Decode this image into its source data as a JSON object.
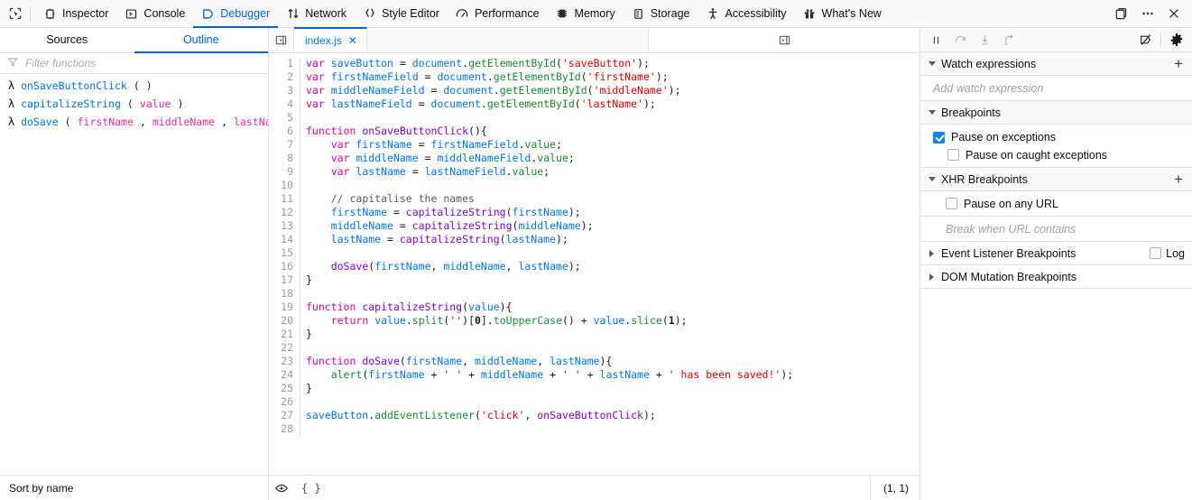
{
  "toolbar": {
    "picker_icon": "element-picker-icon",
    "tools": [
      {
        "label": "Inspector",
        "icon": "inspector-icon",
        "active": false
      },
      {
        "label": "Console",
        "icon": "console-icon",
        "active": false
      },
      {
        "label": "Debugger",
        "icon": "debugger-icon",
        "active": true
      },
      {
        "label": "Network",
        "icon": "network-icon",
        "active": false
      },
      {
        "label": "Style Editor",
        "icon": "style-editor-icon",
        "active": false
      },
      {
        "label": "Performance",
        "icon": "performance-icon",
        "active": false
      },
      {
        "label": "Memory",
        "icon": "memory-icon",
        "active": false
      },
      {
        "label": "Storage",
        "icon": "storage-icon",
        "active": false
      },
      {
        "label": "Accessibility",
        "icon": "accessibility-icon",
        "active": false
      },
      {
        "label": "What's New",
        "icon": "whats-new-icon",
        "active": false
      }
    ],
    "right_buttons": [
      {
        "name": "dock-layout-icon",
        "glyph": "dock"
      },
      {
        "name": "meatball-menu-icon",
        "glyph": "dots"
      },
      {
        "name": "close-devtools-icon",
        "glyph": "close"
      }
    ]
  },
  "left_panel": {
    "tabs": [
      {
        "label": "Sources",
        "active": false
      },
      {
        "label": "Outline",
        "active": true
      }
    ],
    "filter": {
      "value": "",
      "placeholder": "Filter functions",
      "icon": "filter-icon"
    },
    "outline": [
      {
        "symbol": "λ",
        "name": "onSaveButtonClick",
        "open": "(",
        "params": [],
        "close": ")"
      },
      {
        "symbol": "λ",
        "name": "capitalizeString",
        "open": "(",
        "params": [
          "value"
        ],
        "close": ")"
      },
      {
        "symbol": "λ",
        "name": "doSave",
        "open": "(",
        "params": [
          "firstName",
          "middleName",
          "lastName"
        ],
        "close": ")"
      }
    ],
    "footer_label": "Sort by name"
  },
  "editor": {
    "scroll_left_icon": "scroll-tabs-left-icon",
    "scroll_right_icon": "scroll-tabs-right-icon",
    "tab": {
      "label": "index.js",
      "close_glyph": "✕",
      "active": true
    },
    "footer": {
      "eye_icon": "toggle-preview-icon",
      "prettyprint_label": "{ }",
      "cursor_position": "(1, 1)"
    },
    "line_count": 28,
    "lines": [
      {
        "n": 1,
        "tokens": [
          {
            "t": "var",
            "c": "kw"
          },
          {
            "t": " ",
            "c": "pn"
          },
          {
            "t": "saveButton",
            "c": "var"
          },
          {
            "t": " = ",
            "c": "pn"
          },
          {
            "t": "document",
            "c": "var"
          },
          {
            "t": ".",
            "c": "pn"
          },
          {
            "t": "getElementById",
            "c": "meth"
          },
          {
            "t": "(",
            "c": "pn"
          },
          {
            "t": "'saveButton'",
            "c": "str"
          },
          {
            "t": ");",
            "c": "pn"
          }
        ]
      },
      {
        "n": 2,
        "tokens": [
          {
            "t": "var",
            "c": "kw"
          },
          {
            "t": " ",
            "c": "pn"
          },
          {
            "t": "firstNameField",
            "c": "var"
          },
          {
            "t": " = ",
            "c": "pn"
          },
          {
            "t": "document",
            "c": "var"
          },
          {
            "t": ".",
            "c": "pn"
          },
          {
            "t": "getElementById",
            "c": "meth"
          },
          {
            "t": "(",
            "c": "pn"
          },
          {
            "t": "'firstName'",
            "c": "str"
          },
          {
            "t": ");",
            "c": "pn"
          }
        ]
      },
      {
        "n": 3,
        "tokens": [
          {
            "t": "var",
            "c": "kw"
          },
          {
            "t": " ",
            "c": "pn"
          },
          {
            "t": "middleNameField",
            "c": "var"
          },
          {
            "t": " = ",
            "c": "pn"
          },
          {
            "t": "document",
            "c": "var"
          },
          {
            "t": ".",
            "c": "pn"
          },
          {
            "t": "getElementById",
            "c": "meth"
          },
          {
            "t": "(",
            "c": "pn"
          },
          {
            "t": "'middleName'",
            "c": "str"
          },
          {
            "t": ");",
            "c": "pn"
          }
        ]
      },
      {
        "n": 4,
        "tokens": [
          {
            "t": "var",
            "c": "kw"
          },
          {
            "t": " ",
            "c": "pn"
          },
          {
            "t": "lastNameField",
            "c": "var"
          },
          {
            "t": " = ",
            "c": "pn"
          },
          {
            "t": "document",
            "c": "var"
          },
          {
            "t": ".",
            "c": "pn"
          },
          {
            "t": "getElementById",
            "c": "meth"
          },
          {
            "t": "(",
            "c": "pn"
          },
          {
            "t": "'lastName'",
            "c": "str"
          },
          {
            "t": ");",
            "c": "pn"
          }
        ]
      },
      {
        "n": 5,
        "tokens": []
      },
      {
        "n": 6,
        "tokens": [
          {
            "t": "function",
            "c": "kw"
          },
          {
            "t": " ",
            "c": "pn"
          },
          {
            "t": "onSaveButtonClick",
            "c": "fn"
          },
          {
            "t": "(){",
            "c": "pn"
          }
        ]
      },
      {
        "n": 7,
        "tokens": [
          {
            "t": "    ",
            "c": "pn"
          },
          {
            "t": "var",
            "c": "kw"
          },
          {
            "t": " ",
            "c": "pn"
          },
          {
            "t": "firstName",
            "c": "var"
          },
          {
            "t": " = ",
            "c": "pn"
          },
          {
            "t": "firstNameField",
            "c": "var"
          },
          {
            "t": ".",
            "c": "pn"
          },
          {
            "t": "value",
            "c": "meth"
          },
          {
            "t": ";",
            "c": "pn"
          }
        ]
      },
      {
        "n": 8,
        "tokens": [
          {
            "t": "    ",
            "c": "pn"
          },
          {
            "t": "var",
            "c": "kw"
          },
          {
            "t": " ",
            "c": "pn"
          },
          {
            "t": "middleName",
            "c": "var"
          },
          {
            "t": " = ",
            "c": "pn"
          },
          {
            "t": "middleNameField",
            "c": "var"
          },
          {
            "t": ".",
            "c": "pn"
          },
          {
            "t": "value",
            "c": "meth"
          },
          {
            "t": ";",
            "c": "pn"
          }
        ]
      },
      {
        "n": 9,
        "tokens": [
          {
            "t": "    ",
            "c": "pn"
          },
          {
            "t": "var",
            "c": "kw"
          },
          {
            "t": " ",
            "c": "pn"
          },
          {
            "t": "lastName",
            "c": "var"
          },
          {
            "t": " = ",
            "c": "pn"
          },
          {
            "t": "lastNameField",
            "c": "var"
          },
          {
            "t": ".",
            "c": "pn"
          },
          {
            "t": "value",
            "c": "meth"
          },
          {
            "t": ";",
            "c": "pn"
          }
        ]
      },
      {
        "n": 10,
        "tokens": []
      },
      {
        "n": 11,
        "tokens": [
          {
            "t": "    ",
            "c": "pn"
          },
          {
            "t": "// capitalise the names",
            "c": "cmt"
          }
        ]
      },
      {
        "n": 12,
        "tokens": [
          {
            "t": "    ",
            "c": "pn"
          },
          {
            "t": "firstName",
            "c": "var"
          },
          {
            "t": " = ",
            "c": "pn"
          },
          {
            "t": "capitalizeString",
            "c": "fn"
          },
          {
            "t": "(",
            "c": "pn"
          },
          {
            "t": "firstName",
            "c": "var"
          },
          {
            "t": ");",
            "c": "pn"
          }
        ]
      },
      {
        "n": 13,
        "tokens": [
          {
            "t": "    ",
            "c": "pn"
          },
          {
            "t": "middleName",
            "c": "var"
          },
          {
            "t": " = ",
            "c": "pn"
          },
          {
            "t": "capitalizeString",
            "c": "fn"
          },
          {
            "t": "(",
            "c": "pn"
          },
          {
            "t": "middleName",
            "c": "var"
          },
          {
            "t": ");",
            "c": "pn"
          }
        ]
      },
      {
        "n": 14,
        "tokens": [
          {
            "t": "    ",
            "c": "pn"
          },
          {
            "t": "lastName",
            "c": "var"
          },
          {
            "t": " = ",
            "c": "pn"
          },
          {
            "t": "capitalizeString",
            "c": "fn"
          },
          {
            "t": "(",
            "c": "pn"
          },
          {
            "t": "lastName",
            "c": "var"
          },
          {
            "t": ");",
            "c": "pn"
          }
        ]
      },
      {
        "n": 15,
        "tokens": []
      },
      {
        "n": 16,
        "tokens": [
          {
            "t": "    ",
            "c": "pn"
          },
          {
            "t": "doSave",
            "c": "fn"
          },
          {
            "t": "(",
            "c": "pn"
          },
          {
            "t": "firstName",
            "c": "var"
          },
          {
            "t": ", ",
            "c": "pn"
          },
          {
            "t": "middleName",
            "c": "var"
          },
          {
            "t": ", ",
            "c": "pn"
          },
          {
            "t": "lastName",
            "c": "var"
          },
          {
            "t": ");",
            "c": "pn"
          }
        ]
      },
      {
        "n": 17,
        "tokens": [
          {
            "t": "}",
            "c": "pn"
          }
        ]
      },
      {
        "n": 18,
        "tokens": []
      },
      {
        "n": 19,
        "tokens": [
          {
            "t": "function",
            "c": "kw"
          },
          {
            "t": " ",
            "c": "pn"
          },
          {
            "t": "capitalizeString",
            "c": "fn"
          },
          {
            "t": "(",
            "c": "pn"
          },
          {
            "t": "value",
            "c": "var"
          },
          {
            "t": "){",
            "c": "pn"
          }
        ]
      },
      {
        "n": 20,
        "tokens": [
          {
            "t": "    ",
            "c": "pn"
          },
          {
            "t": "return",
            "c": "kw"
          },
          {
            "t": " ",
            "c": "pn"
          },
          {
            "t": "value",
            "c": "var"
          },
          {
            "t": ".",
            "c": "pn"
          },
          {
            "t": "split",
            "c": "meth"
          },
          {
            "t": "(",
            "c": "pn"
          },
          {
            "t": "''",
            "c": "str"
          },
          {
            "t": ")[",
            "c": "pn"
          },
          {
            "t": "0",
            "c": "num"
          },
          {
            "t": "].",
            "c": "pn"
          },
          {
            "t": "toUpperCase",
            "c": "meth"
          },
          {
            "t": "() + ",
            "c": "pn"
          },
          {
            "t": "value",
            "c": "var"
          },
          {
            "t": ".",
            "c": "pn"
          },
          {
            "t": "slice",
            "c": "meth"
          },
          {
            "t": "(",
            "c": "pn"
          },
          {
            "t": "1",
            "c": "num"
          },
          {
            "t": ");",
            "c": "pn"
          }
        ]
      },
      {
        "n": 21,
        "tokens": [
          {
            "t": "}",
            "c": "pn"
          }
        ]
      },
      {
        "n": 22,
        "tokens": []
      },
      {
        "n": 23,
        "tokens": [
          {
            "t": "function",
            "c": "kw"
          },
          {
            "t": " ",
            "c": "pn"
          },
          {
            "t": "doSave",
            "c": "fn"
          },
          {
            "t": "(",
            "c": "pn"
          },
          {
            "t": "firstName",
            "c": "var"
          },
          {
            "t": ", ",
            "c": "pn"
          },
          {
            "t": "middleName",
            "c": "var"
          },
          {
            "t": ", ",
            "c": "pn"
          },
          {
            "t": "lastName",
            "c": "var"
          },
          {
            "t": "){",
            "c": "pn"
          }
        ]
      },
      {
        "n": 24,
        "tokens": [
          {
            "t": "    ",
            "c": "pn"
          },
          {
            "t": "alert",
            "c": "meth"
          },
          {
            "t": "(",
            "c": "pn"
          },
          {
            "t": "firstName",
            "c": "var"
          },
          {
            "t": " + ",
            "c": "pn"
          },
          {
            "t": "' '",
            "c": "str"
          },
          {
            "t": " + ",
            "c": "pn"
          },
          {
            "t": "middleName",
            "c": "var"
          },
          {
            "t": " + ",
            "c": "pn"
          },
          {
            "t": "' '",
            "c": "str"
          },
          {
            "t": " + ",
            "c": "pn"
          },
          {
            "t": "lastName",
            "c": "var"
          },
          {
            "t": " + ",
            "c": "pn"
          },
          {
            "t": "' has been saved!'",
            "c": "str"
          },
          {
            "t": ");",
            "c": "pn"
          }
        ]
      },
      {
        "n": 25,
        "tokens": [
          {
            "t": "}",
            "c": "pn"
          }
        ]
      },
      {
        "n": 26,
        "tokens": []
      },
      {
        "n": 27,
        "tokens": [
          {
            "t": "saveButton",
            "c": "var"
          },
          {
            "t": ".",
            "c": "pn"
          },
          {
            "t": "addEventListener",
            "c": "meth"
          },
          {
            "t": "(",
            "c": "pn"
          },
          {
            "t": "'click'",
            "c": "str"
          },
          {
            "t": ", ",
            "c": "pn"
          },
          {
            "t": "onSaveButtonClick",
            "c": "fn"
          },
          {
            "t": ");",
            "c": "pn"
          }
        ]
      },
      {
        "n": 28,
        "tokens": []
      }
    ]
  },
  "right_panel": {
    "controls": [
      {
        "name": "resume-pause-button",
        "icon": "pause-icon",
        "enabled": true
      },
      {
        "name": "step-over-button",
        "icon": "step-over-icon",
        "enabled": false
      },
      {
        "name": "step-in-button",
        "icon": "step-in-icon",
        "enabled": false
      },
      {
        "name": "step-out-button",
        "icon": "step-out-icon",
        "enabled": false
      },
      {
        "name": "deactivate-breakpoints-button",
        "icon": "breakpoints-disabled-icon",
        "enabled": true
      },
      {
        "name": "debugger-settings-button",
        "icon": "gear-icon",
        "enabled": true
      }
    ],
    "watch": {
      "title": "Watch expressions",
      "add_glyph": "+",
      "placeholder": "Add watch expression",
      "expanded": true
    },
    "breakpoints": {
      "title": "Breakpoints",
      "expanded": true,
      "pause_on_exceptions": {
        "label": "Pause on exceptions",
        "checked": true
      },
      "pause_on_caught": {
        "label": "Pause on caught exceptions",
        "checked": false
      }
    },
    "xhr": {
      "title": "XHR Breakpoints",
      "add_glyph": "+",
      "expanded": true,
      "pause_any_url": {
        "label": "Pause on any URL",
        "checked": false
      },
      "url_placeholder": "Break when URL contains"
    },
    "event_listeners": {
      "title": "Event Listener Breakpoints",
      "expanded": false,
      "log_label": "Log",
      "log_checked": false
    },
    "dom_mutation": {
      "title": "DOM Mutation Breakpoints",
      "expanded": false
    }
  }
}
